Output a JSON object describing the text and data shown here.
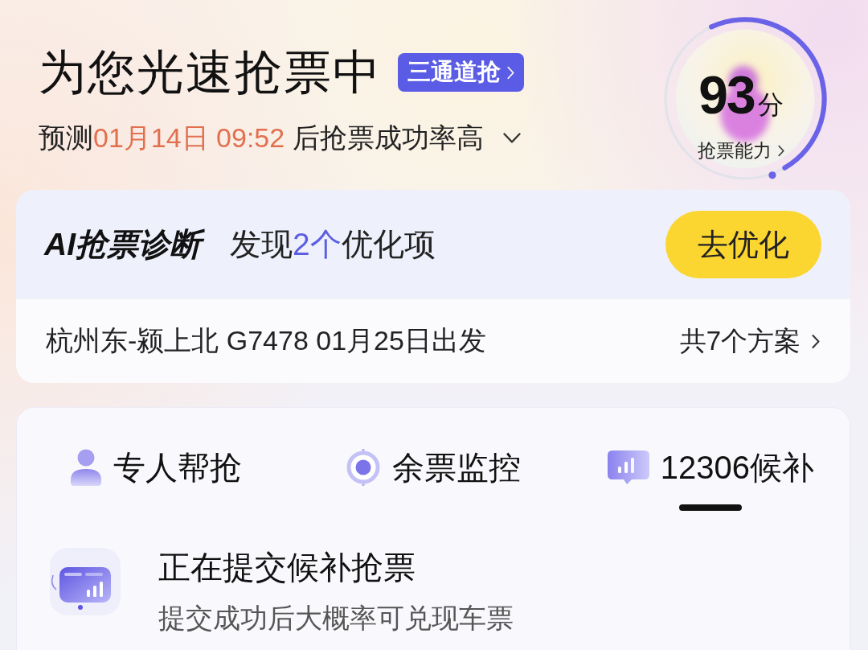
{
  "header": {
    "title": "为您光速抢票中",
    "badge": "三通道抢",
    "forecast": {
      "prefix": "预测",
      "time": "01月14日 09:52",
      "suffix": "后抢票成功率高"
    }
  },
  "score": {
    "value": "93",
    "unit": "分",
    "link": "抢票能力"
  },
  "diagnosis": {
    "title": "AI抢票诊断",
    "finding": {
      "before": "发现",
      "count": "2个",
      "after": "优化项"
    },
    "button": "去优化"
  },
  "route": {
    "text": "杭州东-颍上北 G7478 01月25日出发",
    "plans": "共7个方案"
  },
  "tabs": [
    {
      "kind": "person",
      "label": "专人帮抢",
      "selected": false
    },
    {
      "kind": "target",
      "label": "余票监控",
      "selected": false
    },
    {
      "kind": "chat",
      "label": "12306候补",
      "selected": true
    }
  ],
  "status": {
    "title": "正在提交候补抢票",
    "subtitle": "提交成功后大概率可兑现车票"
  }
}
